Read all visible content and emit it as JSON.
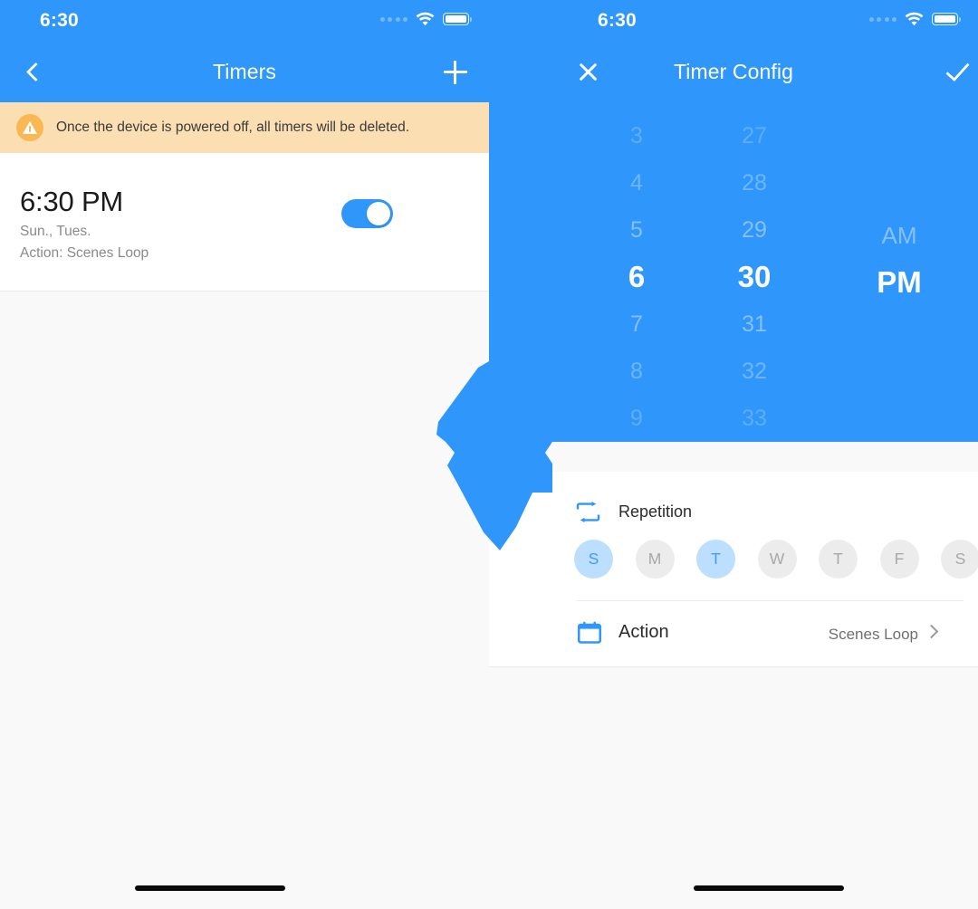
{
  "left_panel": {
    "status_bar": {
      "time": "6:30",
      "signal_icon": "signal-dots-icon",
      "wifi_icon": "wifi-icon",
      "battery_icon": "battery-icon"
    },
    "nav": {
      "back_icon": "chevron-left-icon",
      "title": "Timers",
      "add_icon": "plus-icon"
    },
    "warning": {
      "icon": "warning-triangle-icon",
      "text": "Once the device is powered off, all timers will be deleted."
    },
    "timer_item": {
      "time": "6:30 PM",
      "days": "Sun., Tues.",
      "action": "Action: Scenes Loop",
      "enabled": true,
      "toggle_name": "timer-enable-toggle"
    }
  },
  "right_panel": {
    "status_bar": {
      "time": "6:30",
      "signal_icon": "signal-dots-icon",
      "wifi_icon": "wifi-icon",
      "battery_icon": "battery-icon"
    },
    "nav": {
      "close_icon": "close-icon",
      "title": "Timer Config",
      "confirm_icon": "check-icon"
    },
    "picker": {
      "hours": [
        "3",
        "4",
        "5",
        "6",
        "7",
        "8",
        "9"
      ],
      "minutes": [
        "27",
        "28",
        "29",
        "30",
        "31",
        "32",
        "33"
      ],
      "periods": [
        "",
        "",
        "AM",
        "PM",
        "",
        "",
        ""
      ],
      "selected_hour": "6",
      "selected_minute": "30",
      "selected_period": "PM",
      "selected_index": 3
    },
    "repetition": {
      "icon": "repeat-icon",
      "label": "Repetition",
      "days": [
        {
          "label": "S",
          "selected": true
        },
        {
          "label": "M",
          "selected": false
        },
        {
          "label": "T",
          "selected": true
        },
        {
          "label": "W",
          "selected": false
        },
        {
          "label": "T",
          "selected": false
        },
        {
          "label": "F",
          "selected": false
        },
        {
          "label": "S",
          "selected": false
        }
      ]
    },
    "action": {
      "icon": "calendar-icon",
      "label": "Action",
      "value": "Scenes Loop",
      "chevron_icon": "chevron-right-icon"
    }
  },
  "colors": {
    "brand_blue": "#2f97fb",
    "warning_bg": "#fbdfb2",
    "warning_icon": "#fab852",
    "page_bg": "#f9f9f9",
    "card_bg": "#ffffff",
    "day_off_bg": "#ececec",
    "day_on_bg": "#bcdfff",
    "day_on_text": "#3d9bfb"
  }
}
